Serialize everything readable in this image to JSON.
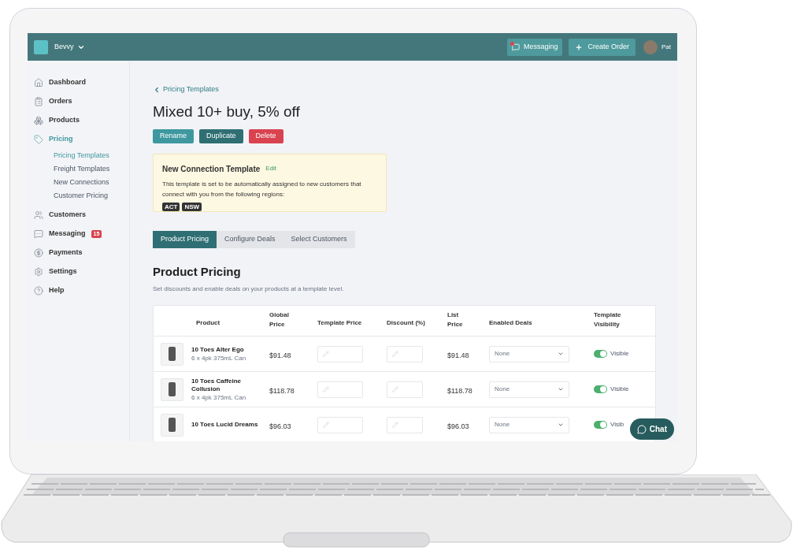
{
  "header": {
    "brand": "Bevvy",
    "messaging_button": "Messaging",
    "messaging_unread": true,
    "create_button": "Create Order",
    "user": "Pat"
  },
  "sidebar": {
    "items": [
      {
        "label": "Dashboard",
        "selected": false
      },
      {
        "label": "Orders",
        "selected": false
      },
      {
        "label": "Products",
        "selected": false
      },
      {
        "label": "Pricing",
        "selected": true,
        "children": [
          {
            "label": "Pricing Templates",
            "selected": true
          },
          {
            "label": "Freight Templates",
            "selected": false
          },
          {
            "label": "New Connections",
            "selected": false
          },
          {
            "label": "Customer Pricing",
            "selected": false
          }
        ]
      },
      {
        "label": "Customers",
        "selected": false
      },
      {
        "label": "Messaging",
        "selected": false,
        "badge": "15"
      },
      {
        "label": "Payments",
        "selected": false
      },
      {
        "label": "Settings",
        "selected": false
      },
      {
        "label": "Help",
        "selected": false
      }
    ]
  },
  "breadcrumb": "Pricing Templates",
  "title": "Mixed 10+ buy, 5% off",
  "actions": [
    {
      "label": "Rename",
      "kind": "primary"
    },
    {
      "label": "Duplicate",
      "kind": "dark"
    },
    {
      "label": "Delete",
      "kind": "danger"
    }
  ],
  "notice": {
    "title": "New Connection Template",
    "link": "Edit",
    "text": "This template is set to be automatically assigned to new customers that connect with you from the following regions:",
    "tags": [
      "ACT",
      "NSW"
    ]
  },
  "tabs": [
    {
      "label": "Product Pricing",
      "selected": true
    },
    {
      "label": "Configure Deals",
      "selected": false
    },
    {
      "label": "Select Customers",
      "selected": false
    }
  ],
  "section": {
    "title": "Product Pricing",
    "subtitle": "Set discounts and enable deals on your products at a template level."
  },
  "table": {
    "columns": [
      "Product",
      "Global Price",
      "Template Price",
      "Discount (%)",
      "List Price",
      "Enabled Deals",
      "Template Visibility"
    ],
    "rows": [
      {
        "name": "10 Toes Alter Ego",
        "pack": "6 x 4pk 375mL Can",
        "global_price": "$91.48",
        "list_price": "$91.48",
        "deal": "None",
        "visible": true,
        "visibility": "Visible"
      },
      {
        "name": "10 Toes Caffeine Collusion",
        "pack": "6 x 4pk 375mL Can",
        "global_price": "$118.78",
        "list_price": "$118.78",
        "deal": "None",
        "visible": true,
        "visibility": "Visible"
      },
      {
        "name": "10 Toes Lucid Dreams",
        "global_price": "$96.03",
        "list_price": "$96.03",
        "deal": "None",
        "visible": true,
        "visibility": "Visib"
      }
    ]
  },
  "chat_button": "Chat"
}
